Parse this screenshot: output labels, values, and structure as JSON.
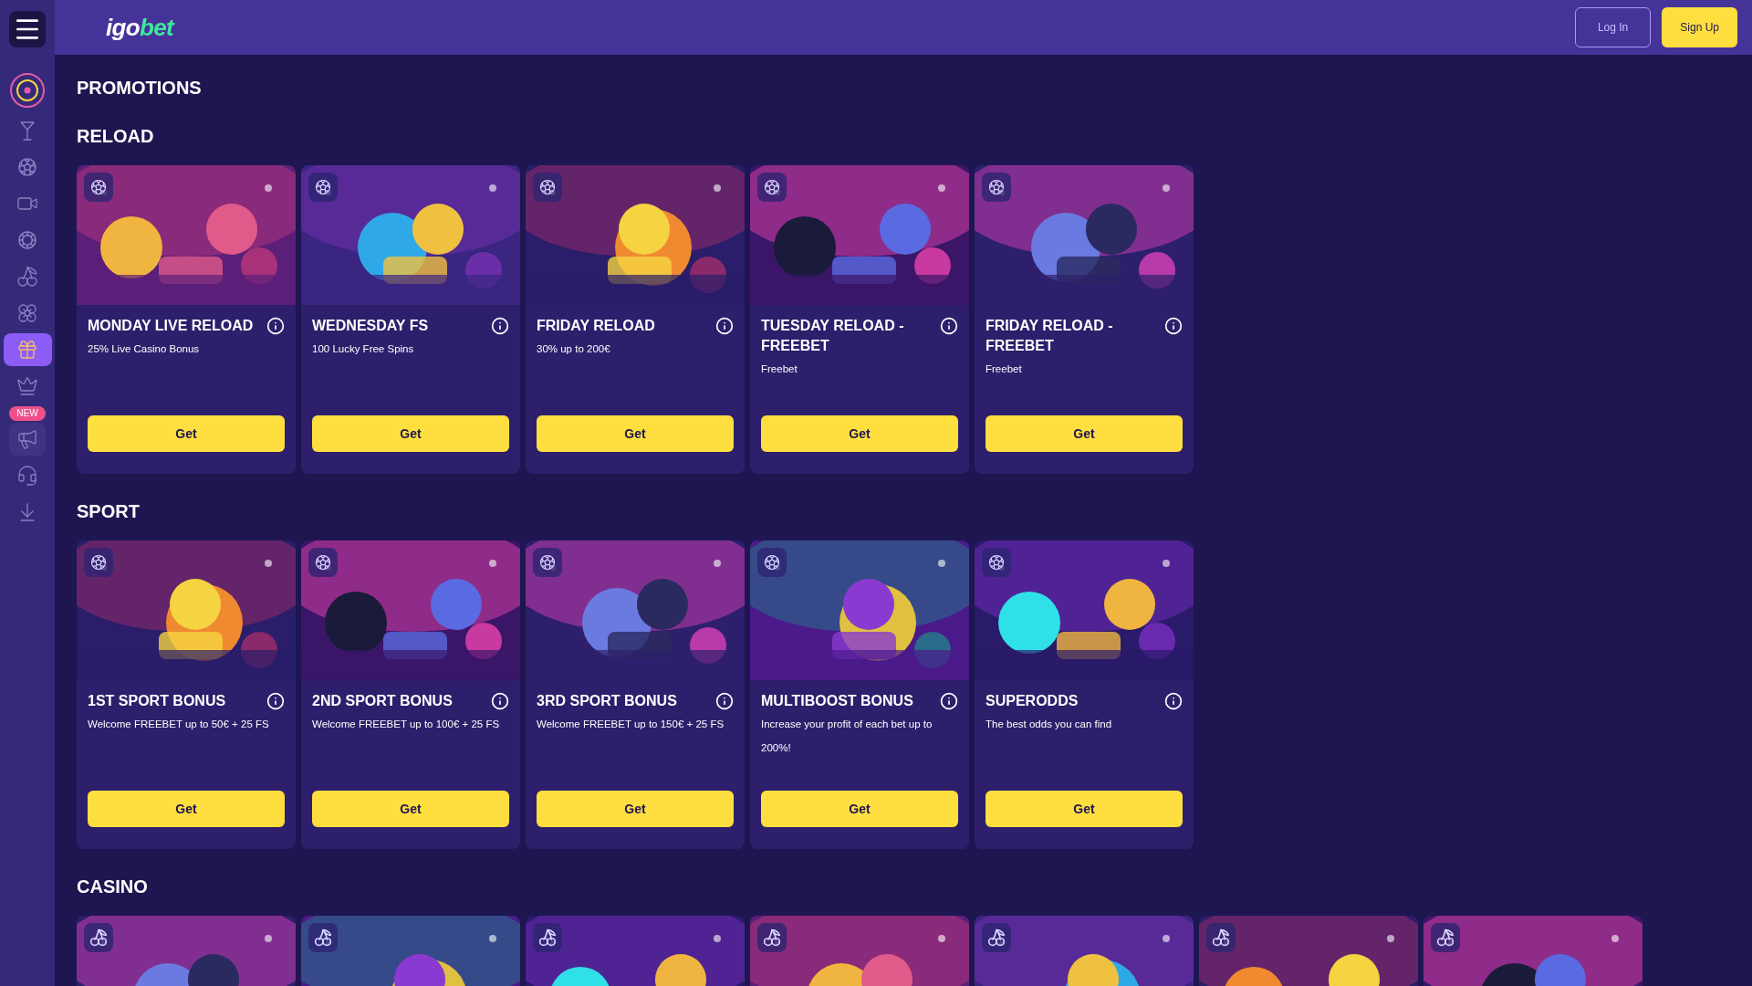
{
  "logo": {
    "lead": "igo",
    "accent": "bet"
  },
  "header_buttons": [
    {
      "kind": "outline",
      "label": "Log In"
    },
    {
      "kind": "filled",
      "label": "Sign Up"
    }
  ],
  "sidebar": {
    "items": [
      {
        "kind": "target",
        "selected": false
      },
      {
        "kind": "cocktail",
        "selected": false
      },
      {
        "kind": "soccer",
        "selected": false
      },
      {
        "kind": "live",
        "selected": false
      },
      {
        "kind": "chip",
        "selected": false
      },
      {
        "kind": "cherries",
        "selected": false
      },
      {
        "kind": "flower",
        "selected": false
      },
      {
        "kind": "gift",
        "selected": true
      },
      {
        "kind": "crown",
        "selected": false
      },
      {
        "kind": "megaphone",
        "selected": false,
        "badge": "NEW"
      },
      {
        "kind": "support",
        "selected": false
      },
      {
        "kind": "download",
        "selected": false
      }
    ]
  },
  "page_title": "PROMOTIONS",
  "sections": [
    {
      "title": "RELOAD",
      "cards": [
        {
          "kind": "soccer",
          "title": "MONDAY LIVE RELOAD",
          "subtitle": "25% Live Casino Bonus",
          "button": "Get"
        },
        {
          "kind": "soccer",
          "title": "WEDNESDAY FS",
          "subtitle": "100 Lucky Free Spins",
          "button": "Get"
        },
        {
          "kind": "soccer",
          "title": "FRIDAY RELOAD",
          "subtitle": "30% up to 200€",
          "button": "Get"
        },
        {
          "kind": "soccer",
          "title": "TUESDAY RELOAD - FREEBET",
          "subtitle": "Freebet",
          "button": "Get"
        },
        {
          "kind": "soccer",
          "title": "FRIDAY RELOAD - FREEBET",
          "subtitle": "Freebet",
          "button": "Get"
        }
      ]
    },
    {
      "title": "SPORT",
      "cards": [
        {
          "kind": "soccer",
          "title": "1ST SPORT BONUS",
          "subtitle": "Welcome FREEBET up to 50€ + 25 FS",
          "button": "Get"
        },
        {
          "kind": "soccer",
          "title": "2ND SPORT BONUS",
          "subtitle": "Welcome FREEBET up to 100€ + 25 FS",
          "button": "Get"
        },
        {
          "kind": "soccer",
          "title": "3RD SPORT BONUS",
          "subtitle": "Welcome FREEBET up to 150€ + 25 FS",
          "button": "Get"
        },
        {
          "kind": "soccer",
          "title": "MULTIBOOST BONUS",
          "subtitle": "Increase your profit of each bet up to 200%!",
          "button": "Get"
        },
        {
          "kind": "soccer",
          "title": "SUPERODDS",
          "subtitle": "The best odds you can find",
          "button": "Get"
        }
      ]
    },
    {
      "title": "CASINO",
      "cards": [
        {
          "kind": "cherries"
        },
        {
          "kind": "cherries"
        },
        {
          "kind": "cherries"
        },
        {
          "kind": "cherries"
        },
        {
          "kind": "cherries"
        },
        {
          "kind": "cherries"
        },
        {
          "kind": "cherries"
        }
      ]
    }
  ]
}
